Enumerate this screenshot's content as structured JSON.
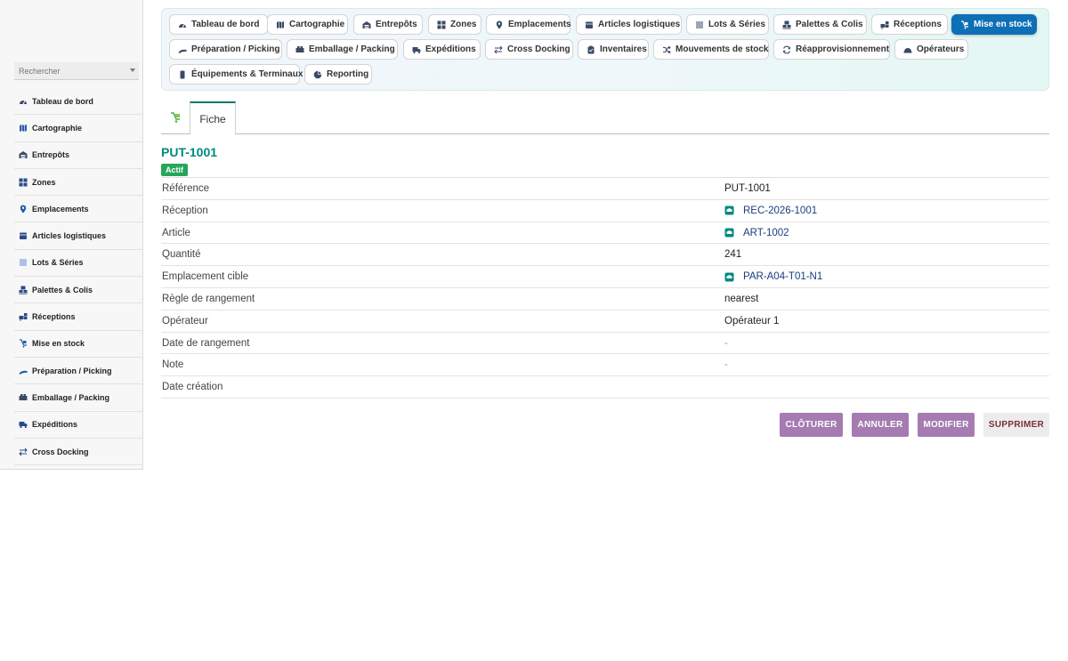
{
  "sidebar": {
    "search_placeholder": "Rechercher",
    "items": [
      {
        "label": "Tableau de bord",
        "icon": "dashboard-icon"
      },
      {
        "label": "Cartographie",
        "icon": "map-icon"
      },
      {
        "label": "Entrepôts",
        "icon": "warehouse-icon"
      },
      {
        "label": "Zones",
        "icon": "grid-icon"
      },
      {
        "label": "Emplacements",
        "icon": "location-pin-icon"
      },
      {
        "label": "Articles logistiques",
        "icon": "box-icon"
      },
      {
        "label": "Lots & Séries",
        "icon": "list-icon"
      },
      {
        "label": "Palettes & Colis",
        "icon": "pallet-icon"
      },
      {
        "label": "Réceptions",
        "icon": "receiving-icon"
      },
      {
        "label": "Mise en stock",
        "icon": "putaway-icon"
      },
      {
        "label": "Préparation / Picking",
        "icon": "picking-icon"
      },
      {
        "label": "Emballage / Packing",
        "icon": "packing-icon"
      },
      {
        "label": "Expéditions",
        "icon": "truck-icon"
      },
      {
        "label": "Cross Docking",
        "icon": "swap-icon"
      }
    ]
  },
  "modules": [
    {
      "label": "Tableau de bord",
      "icon": "dashboard-icon",
      "active": false
    },
    {
      "label": "Cartographie",
      "icon": "map-icon",
      "active": false
    },
    {
      "label": "Entrepôts",
      "icon": "warehouse-icon",
      "active": false
    },
    {
      "label": "Zones",
      "icon": "grid-icon",
      "active": false
    },
    {
      "label": "Emplacements",
      "icon": "location-pin-icon",
      "active": false
    },
    {
      "label": "Articles logistiques",
      "icon": "box-icon",
      "active": false
    },
    {
      "label": "Lots & Séries",
      "icon": "list-icon",
      "active": false
    },
    {
      "label": "Palettes & Colis",
      "icon": "pallet-icon",
      "active": false
    },
    {
      "label": "Réceptions",
      "icon": "receiving-icon",
      "active": false
    },
    {
      "label": "Mise en stock",
      "icon": "putaway-icon",
      "active": true
    },
    {
      "label": "Préparation / Picking",
      "icon": "picking-icon",
      "active": false
    },
    {
      "label": "Emballage / Packing",
      "icon": "packing-icon",
      "active": false
    },
    {
      "label": "Expéditions",
      "icon": "truck-icon",
      "active": false
    },
    {
      "label": "Cross Docking",
      "icon": "swap-icon",
      "active": false
    },
    {
      "label": "Inventaires",
      "icon": "clipboard-icon",
      "active": false
    },
    {
      "label": "Mouvements de stock",
      "icon": "shuffle-icon",
      "active": false
    },
    {
      "label": "Réapprovisionnement",
      "icon": "refresh-icon",
      "active": false
    },
    {
      "label": "Opérateurs",
      "icon": "helmet-icon",
      "active": false
    },
    {
      "label": "Équipements & Terminaux",
      "icon": "device-icon",
      "active": false
    },
    {
      "label": "Reporting",
      "icon": "pie-chart-icon",
      "active": false
    }
  ],
  "tabs": {
    "icon": "putaway-icon",
    "fiche": "Fiche"
  },
  "record": {
    "title": "PUT-1001",
    "status": "Actif",
    "fields": [
      {
        "label": "Référence",
        "value": "PUT-1001",
        "type": "text"
      },
      {
        "label": "Réception",
        "value": "REC-2026-1001",
        "type": "link"
      },
      {
        "label": "Article",
        "value": "ART-1002",
        "type": "link"
      },
      {
        "label": "Quantité",
        "value": "241",
        "type": "text"
      },
      {
        "label": "Emplacement cible",
        "value": "PAR-A04-T01-N1",
        "type": "link"
      },
      {
        "label": "Règle de rangement",
        "value": "nearest",
        "type": "text"
      },
      {
        "label": "Opérateur",
        "value": "Opérateur 1",
        "type": "text"
      },
      {
        "label": "Date de rangement",
        "value": "-",
        "type": "dash"
      },
      {
        "label": "Note",
        "value": "-",
        "type": "dash"
      },
      {
        "label": "Date création",
        "value": "",
        "type": "text"
      }
    ]
  },
  "actions": {
    "close": "CLÔTURER",
    "cancel": "ANNULER",
    "edit": "MODIFIER",
    "delete": "SUPPRIMER"
  },
  "colors": {
    "active_module": "#0d6fb5",
    "title_teal": "#00897b",
    "badge_green": "#26a65b",
    "action_purple": "#a57bb1",
    "delete_text": "#7b2d3a",
    "link_icon": "#00897b"
  }
}
